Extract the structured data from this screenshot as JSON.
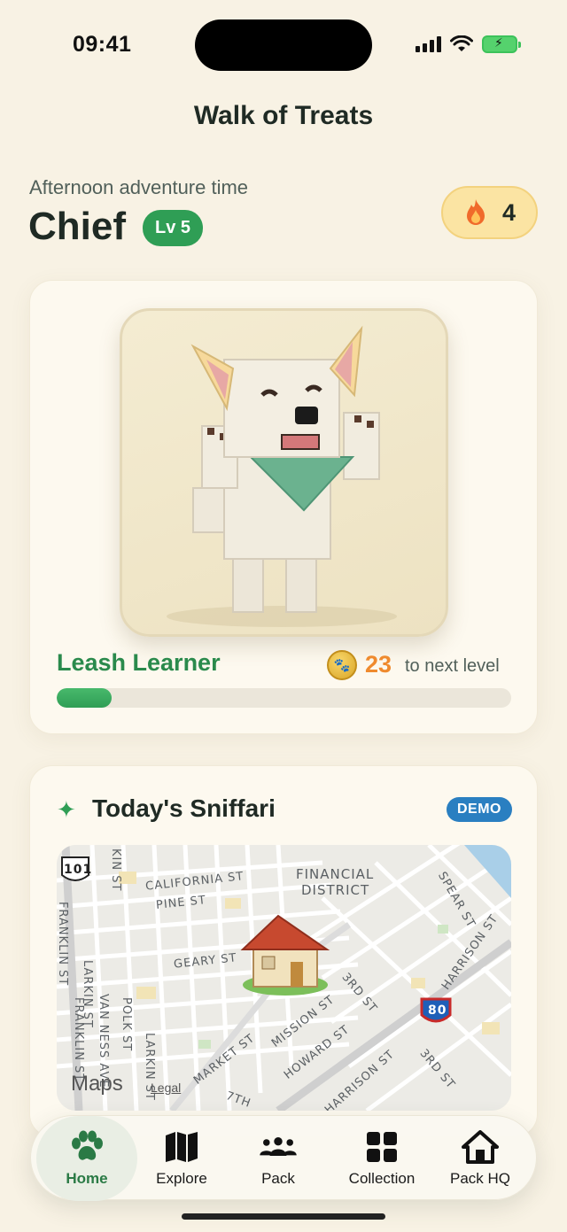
{
  "status_bar": {
    "time": "09:41"
  },
  "app": {
    "title": "Walk of Treats"
  },
  "header": {
    "greeting": "Afternoon adventure time",
    "dog_name": "Chief",
    "level": "Lv 5",
    "streak": "4"
  },
  "dog_card": {
    "rank_title": "Leash Learner",
    "xp_remaining": "23",
    "xp_label": "to next level",
    "progress_fraction": 0.12
  },
  "sniffari": {
    "title": "Today's Sniffari",
    "badge": "DEMO",
    "map": {
      "brand": "Maps",
      "legal": "Legal",
      "labels": {
        "hwy101": "101",
        "hwy80": "80",
        "california": "CALIFORNIA ST",
        "pine": "PINE ST",
        "financial": "FINANCIAL",
        "district": "DISTRICT",
        "geary": "GEARY ST",
        "larkin1": "LARKIN ST",
        "larkin2": "LARKIN ST",
        "franklin1": "FRANKLIN ST",
        "franklin2": "FRANKLIN ST",
        "vanness": "VAN NESS AVE",
        "polk": "POLK ST",
        "kinst": "KIN ST",
        "spear": "SPEAR ST",
        "harrison1": "HARRISON ST",
        "harrison2": "HARRISON ST",
        "third1": "3RD ST",
        "third2": "3RD ST",
        "mission": "MISSION ST",
        "howard": "HOWARD ST",
        "market": "MARKET ST",
        "seventh": "7TH"
      }
    }
  },
  "tabs": [
    {
      "label": "Home",
      "icon": "paw-icon",
      "active": true
    },
    {
      "label": "Explore",
      "icon": "map-icon",
      "active": false
    },
    {
      "label": "Pack",
      "icon": "group-icon",
      "active": false
    },
    {
      "label": "Collection",
      "icon": "grid-icon",
      "active": false
    },
    {
      "label": "Pack HQ",
      "icon": "house-icon",
      "active": false
    }
  ],
  "colors": {
    "background": "#f8f2e4",
    "accent_green": "#2f9e55",
    "demo_blue": "#2a7fc1",
    "xp_orange": "#ef8a2e"
  }
}
